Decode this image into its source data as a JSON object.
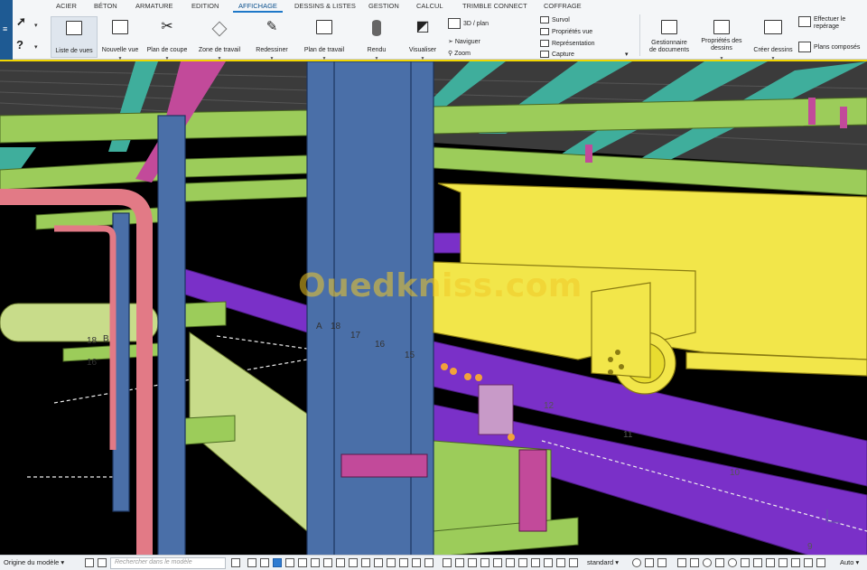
{
  "ribbon": {
    "tabs": [
      "ACIER",
      "BÉTON",
      "ARMATURE",
      "EDITION",
      "AFFICHAGE",
      "DESSINS & LISTES",
      "GESTION",
      "CALCUL",
      "TRIMBLE CONNECT",
      "COFFRAGE"
    ],
    "active_tab": "AFFICHAGE",
    "commands": {
      "liste_vues": "Liste de vues",
      "nouvelle_vue": "Nouvelle vue",
      "plan_coupe": "Plan de coupe",
      "zone_travail": "Zone de travail",
      "redessiner": "Redessiner",
      "plan_travail": "Plan de travail",
      "rendu": "Rendu",
      "visualiser": "Visualiser",
      "vue_3d_plan": "3D / plan",
      "naviguer": "Naviguer",
      "zoom": "Zoom",
      "survol": "Survol",
      "proprietes_vue": "Propriétés vue",
      "representation": "Représentation",
      "capture": "Capture",
      "gestionnaire_l1": "Gestionnaire",
      "gestionnaire_l2": "de documents",
      "proprietes_dessins_l1": "Propriétés des",
      "proprietes_dessins_l2": "dessins",
      "creer_dessins": "Créer dessins",
      "effectuer_l1": "Effectuer le",
      "effectuer_l2": "repérage",
      "plans_composes": "Plans composés"
    },
    "icons": [
      "select-arrow-icon",
      "help-icon",
      "view-list-icon",
      "new-view-icon",
      "scissors-icon",
      "work-area-icon",
      "redraw-icon",
      "work-plane-icon",
      "render-icon",
      "visualize-icon"
    ]
  },
  "viewport": {
    "labels": {
      "a": "A",
      "n18a": "18",
      "n17": "17",
      "n16a": "16",
      "n15": "15",
      "n18b": "18",
      "b": "B",
      "n16b": "16",
      "n12": "12",
      "n11": "11",
      "n10": "10",
      "n9": "9"
    },
    "watermark": "Ouedkniss.com",
    "colors": {
      "background": "#000000",
      "steel_blue": "#4a6fa8",
      "beam_green": "#9ccc5a",
      "rail_purple": "#7a30c8",
      "crane_yellow": "#f2e64a",
      "pipe_red": "#e27a86",
      "brace_magenta": "#c24a9a",
      "deck_teal": "#3fae9c",
      "pipe_lime": "#c8dc8a"
    }
  },
  "status": {
    "origin": "Origine du modèle",
    "search_placeholder": "Rechercher dans le modèle",
    "filter": "standard",
    "zoom_mode": "Auto"
  }
}
